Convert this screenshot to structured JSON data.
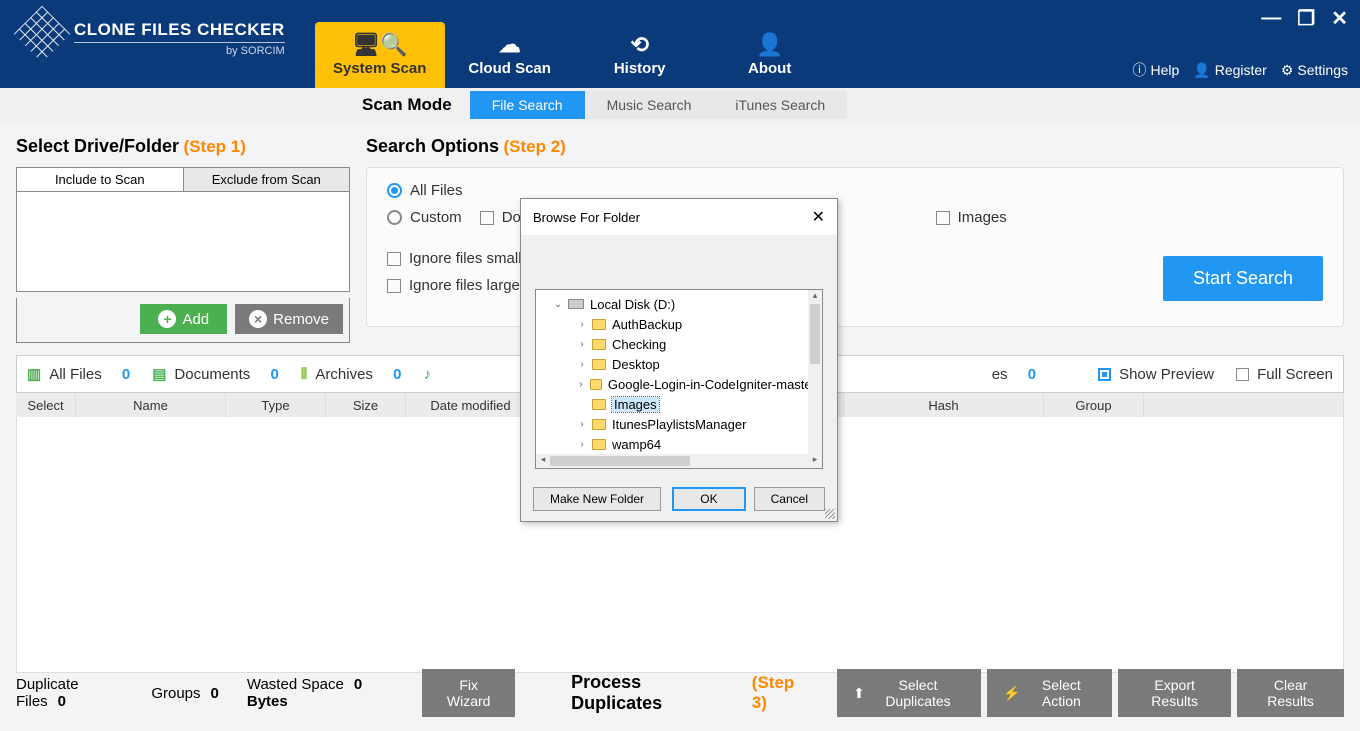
{
  "app": {
    "title": "CLONE FILES CHECKER",
    "subtitle": "by SORCIM"
  },
  "nav_tabs": {
    "system_scan": "System Scan",
    "cloud_scan": "Cloud Scan",
    "history": "History",
    "about": "About"
  },
  "header_links": {
    "help": "Help",
    "register": "Register",
    "settings": "Settings"
  },
  "scan_mode": {
    "label": "Scan Mode",
    "file": "File Search",
    "music": "Music Search",
    "itunes": "iTunes Search"
  },
  "left": {
    "title": "Select Drive/Folder",
    "step": "(Step 1)",
    "tab_include": "Include to Scan",
    "tab_exclude": "Exclude from Scan",
    "add": "Add",
    "remove": "Remove"
  },
  "right": {
    "title": "Search Options",
    "step": "(Step 2)",
    "all_files": "All Files",
    "custom": "Custom",
    "documents": "Documents",
    "images": "Images",
    "ignore_smaller": "Ignore files smaller than",
    "ignore_larger": "Ignore files larger than",
    "start_search": "Start Search"
  },
  "filters": {
    "all_files": "All Files",
    "all_files_count": "0",
    "documents": "Documents",
    "documents_count": "0",
    "archives": "Archives",
    "archives_count": "0",
    "es_suffix": "es",
    "es_count": "0",
    "show_preview": "Show Preview",
    "full_screen": "Full Screen"
  },
  "columns": {
    "select": "Select",
    "name": "Name",
    "type": "Type",
    "size": "Size",
    "date_modified": "Date modified",
    "hash": "Hash",
    "group": "Group"
  },
  "footer": {
    "dup_label": "Duplicate Files",
    "dup_count": "0",
    "groups_label": "Groups",
    "groups_count": "0",
    "wasted_label": "Wasted Space",
    "wasted_value": "0 Bytes",
    "fix": "Fix Wizard",
    "process": "Process Duplicates",
    "step": "(Step 3)",
    "select_dup": "Select Duplicates",
    "select_action": "Select Action",
    "export": "Export Results",
    "clear": "Clear Results"
  },
  "dialog": {
    "title": "Browse For Folder",
    "drive": "Local Disk (D:)",
    "folders": [
      "AuthBackup",
      "Checking",
      "Desktop",
      "Google-Login-in-CodeIgniter-master",
      "Images",
      "ItunesPlaylistsManager",
      "wamp64"
    ],
    "selected": "Images",
    "new_folder": "Make New Folder",
    "ok": "OK",
    "cancel": "Cancel"
  }
}
